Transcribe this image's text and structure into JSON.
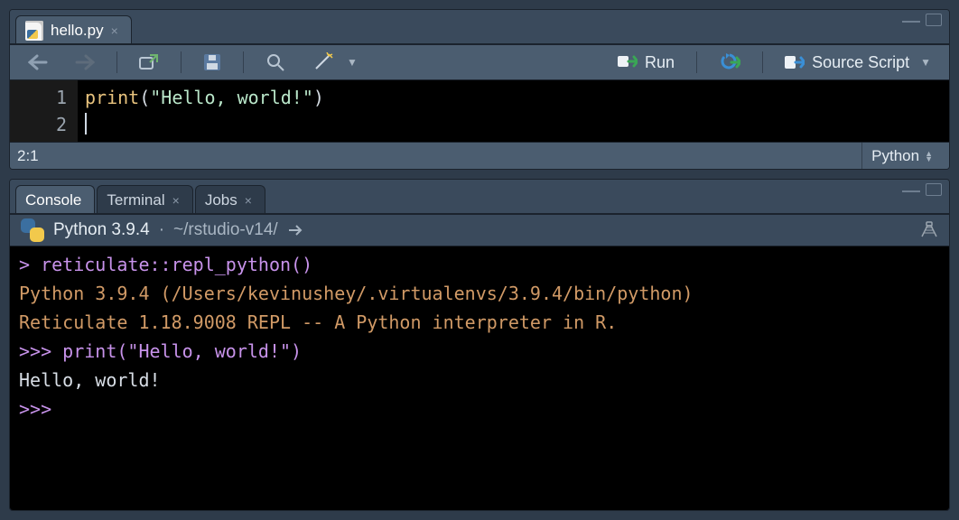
{
  "editor": {
    "tab": {
      "filename": "hello.py"
    },
    "toolbar": {
      "run_label": "Run",
      "source_label": "Source Script"
    },
    "gutter": [
      "1",
      "2"
    ],
    "code": {
      "func": "print",
      "open": "(",
      "str": "\"Hello, world!\"",
      "close": ")"
    },
    "status": {
      "cursor": "2:1",
      "language": "Python"
    }
  },
  "lower_tabs": {
    "console": "Console",
    "terminal": "Terminal",
    "jobs": "Jobs"
  },
  "console_header": {
    "interp": "Python 3.9.4",
    "sep": "·",
    "path": "~/rstudio-v14/"
  },
  "console_lines": [
    {
      "cls": "c-prompt",
      "text": "> reticulate::repl_python()"
    },
    {
      "cls": "c-info",
      "text": "Python 3.9.4 (/Users/kevinushey/.virtualenvs/3.9.4/bin/python)"
    },
    {
      "cls": "c-info",
      "text": "Reticulate 1.18.9008 REPL -- A Python interpreter in R."
    },
    {
      "cls": "c-cmd",
      "text": ">>> print(\"Hello, world!\")"
    },
    {
      "cls": "c-out",
      "text": "Hello, world!"
    },
    {
      "cls": "c-cmd",
      "text": ">>> "
    }
  ]
}
